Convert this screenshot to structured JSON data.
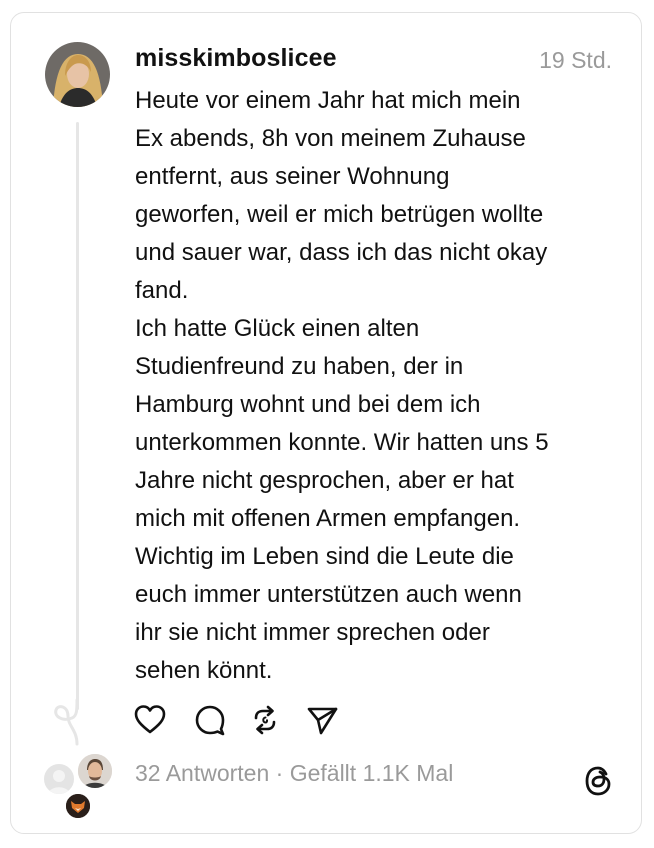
{
  "post": {
    "username": "misskimboslicee",
    "time": "19 Std.",
    "lines": [
      "Heute vor einem Jahr hat mich mein",
      "Ex abends, 8h von meinem Zuhause",
      "entfernt, aus seiner Wohnung",
      "geworfen, weil er mich betrügen wollte",
      "und sauer war, dass ich das nicht okay",
      "fand.",
      "Ich hatte Glück einen alten",
      "Studienfreund zu haben, der in",
      "Hamburg wohnt und bei dem ich",
      "unterkommen konnte. Wir hatten uns 5",
      "Jahre nicht gesprochen, aber er hat",
      "mich mit offenen Armen empfangen.",
      "Wichtig im Leben sind die Leute die",
      "euch immer unterstützen auch wenn",
      "ihr sie nicht immer sprechen oder",
      "sehen könnt."
    ]
  },
  "actions": {
    "like": "heart-icon",
    "reply": "comment-icon",
    "repost": "repost-icon",
    "share": "send-icon"
  },
  "footer": {
    "stats": "32 Antworten · Gefällt 1.1K Mal"
  },
  "colors": {
    "text": "#111111",
    "muted": "#9a9a9a",
    "border": "#e1e1e1",
    "thread_line": "#e6e6e6"
  }
}
